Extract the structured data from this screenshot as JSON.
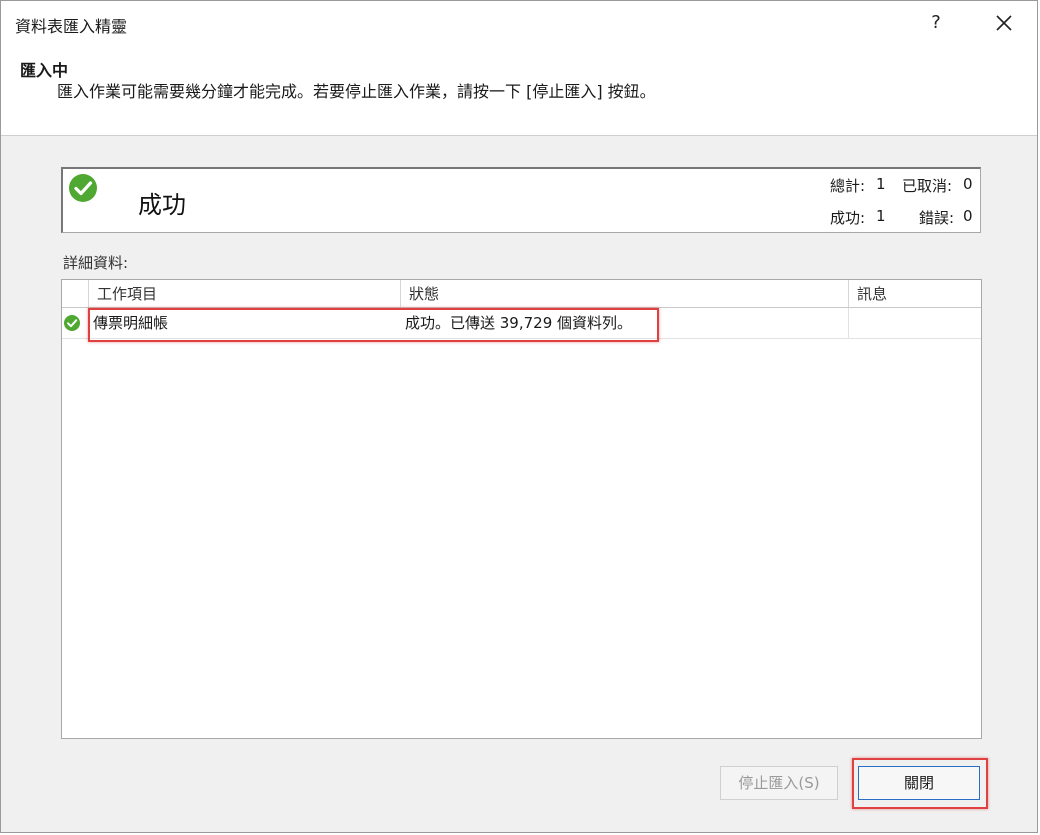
{
  "window": {
    "title": "資料表匯入精靈",
    "help_label": "?",
    "close_icon": "close-icon"
  },
  "header": {
    "heading": "匯入中",
    "description": "匯入作業可能需要幾分鐘才能完成。若要停止匯入作業，請按一下 [停止匯入] 按鈕。"
  },
  "status": {
    "icon": "success-check-icon",
    "label": "成功",
    "total_label": "總計:",
    "total_value": "1",
    "cancelled_label": "已取消:",
    "cancelled_value": "0",
    "success_label": "成功:",
    "success_value": "1",
    "error_label": "錯誤:",
    "error_value": "0"
  },
  "details": {
    "label": "詳細資料:",
    "columns": [
      "工作項目",
      "狀態",
      "訊息"
    ],
    "rows": [
      {
        "icon": "success-check-icon",
        "item": "傳票明細帳",
        "status": "成功。已傳送 39,729 個資料列。",
        "message": ""
      }
    ]
  },
  "buttons": {
    "stop_label": "停止匯入(S)",
    "close_label": "關閉"
  },
  "colors": {
    "success_green": "#4fa832",
    "highlight_red": "#e04040",
    "focus_blue": "#2b6cc4"
  }
}
